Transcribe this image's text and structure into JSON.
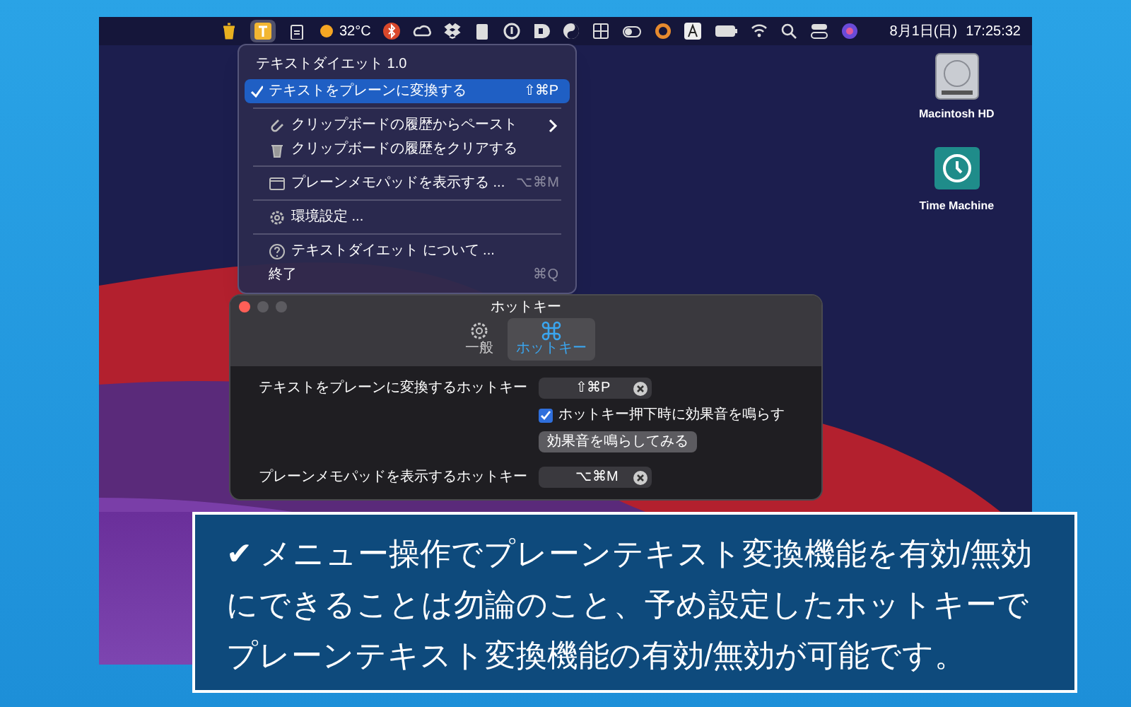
{
  "menubar": {
    "app_icon_selected": true,
    "temperature": "32°C",
    "date": "8月1日(日)",
    "time": "17:25:32"
  },
  "menu": {
    "title": "テキストダイエット 1.0",
    "items": [
      {
        "kind": "item",
        "label": "テキストをプレーンに変換する",
        "shortcut": "⇧⌘P",
        "checked": true,
        "selected": true
      },
      {
        "kind": "separator"
      },
      {
        "kind": "item",
        "label": "クリップボードの履歴からペースト",
        "checked": false,
        "selected": false,
        "submenu": true
      },
      {
        "kind": "item",
        "label": "クリップボードの履歴をクリアする",
        "checked": false,
        "selected": false
      },
      {
        "kind": "separator"
      },
      {
        "kind": "item",
        "label": "プレーンメモパッドを表示する ...",
        "shortcut": "⌥⌘M",
        "checked": false,
        "selected": false
      },
      {
        "kind": "separator"
      },
      {
        "kind": "item",
        "label": "環境設定 ...",
        "checked": false,
        "selected": false
      },
      {
        "kind": "separator"
      },
      {
        "kind": "item",
        "label": "テキストダイエット について ...",
        "checked": false,
        "selected": false
      },
      {
        "kind": "item",
        "label": "終了",
        "shortcut": "⌘Q",
        "checked": false,
        "selected": false
      }
    ]
  },
  "window": {
    "title": "ホットキー",
    "tabs": [
      {
        "label": "一般",
        "selected": false
      },
      {
        "label": "ホットキー",
        "selected": true
      }
    ],
    "rows": [
      {
        "kind": "hotkey",
        "label": "テキストをプレーンに変換するホットキー",
        "value": "⇧⌘P"
      },
      {
        "kind": "checkbox",
        "label": "ホットキー押下時に効果音を鳴らす",
        "checked": true
      },
      {
        "kind": "button",
        "label": "効果音を鳴らしてみる"
      },
      {
        "kind": "hotkey",
        "label": "プレーンメモパッドを表示するホットキー",
        "value": "⌥⌘M"
      }
    ]
  },
  "desktop_icons": [
    {
      "label": "Macintosh HD"
    },
    {
      "label": "Time Machine"
    }
  ],
  "caption": {
    "lines": [
      "✔ メニュー操作でプレーンテキスト変換機能を有効/無効",
      "にできることは勿論のこと、予め設定したホットキーで",
      "プレーンテキスト変換機能の有効/無効が可能です。"
    ]
  }
}
